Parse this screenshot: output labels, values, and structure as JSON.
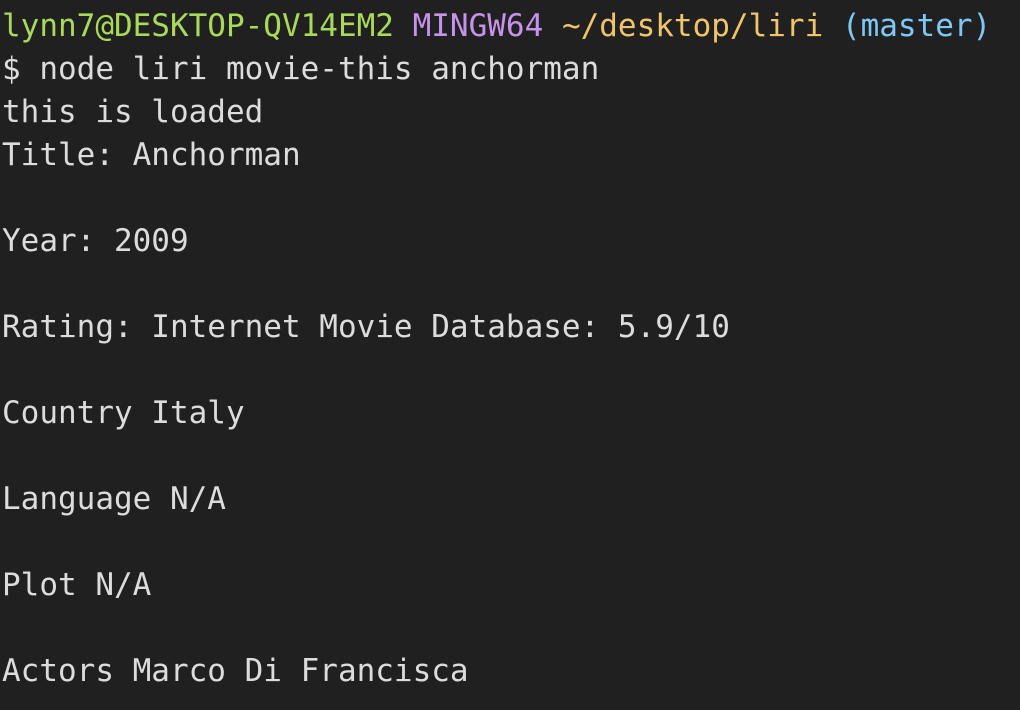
{
  "prompt": {
    "user_host": "lynn7@DESKTOP-QV14EM2",
    "shell": "MINGW64",
    "path": "~/desktop/liri",
    "branch": "(master)",
    "user_color": "#a8d95a",
    "shell_color": "#c792ea",
    "path_color": "#f0c46a",
    "branch_color": "#7ec8f5"
  },
  "command": "$ node liri movie-this anchorman",
  "output": {
    "loaded": "this is loaded",
    "title": "Title: Anchorman",
    "year": "Year: 2009",
    "rating": "Rating: Internet Movie Database: 5.9/10",
    "country": "Country Italy",
    "language": "Language N/A",
    "plot": "Plot N/A",
    "actors": "Actors Marco Di Francisca"
  },
  "colors": {
    "background": "#202020",
    "foreground": "#dcdcdc"
  }
}
